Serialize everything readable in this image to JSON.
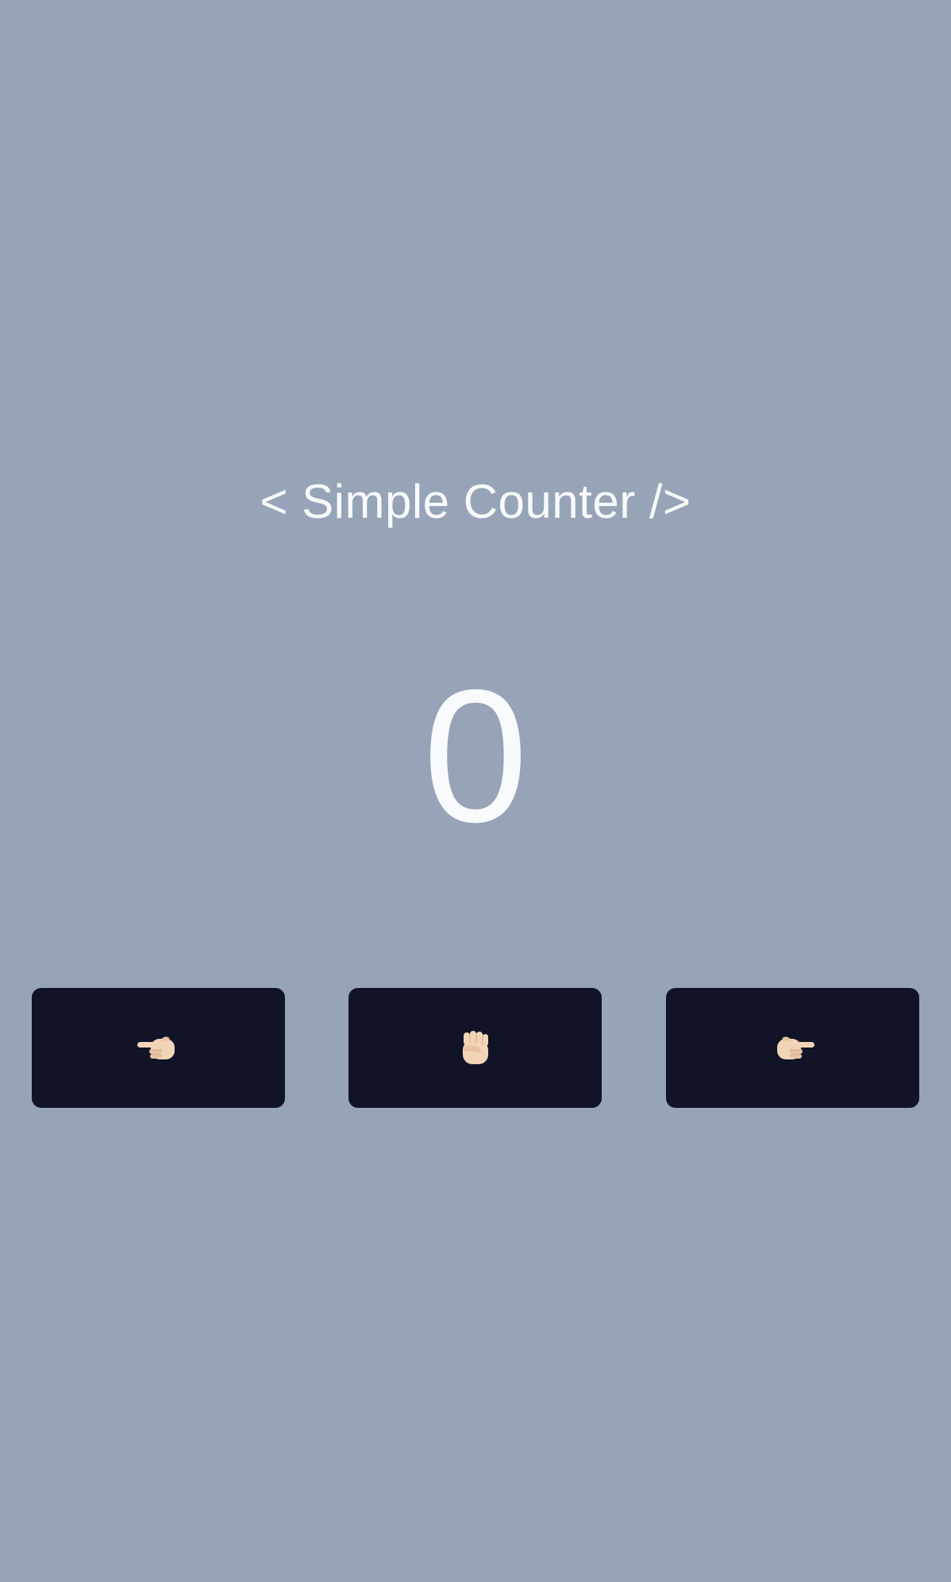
{
  "app": {
    "title": "< Simple Counter />"
  },
  "counter": {
    "value": "0"
  },
  "buttons": [
    {
      "name": "decrement-button",
      "icon": "pointing-left-hand-icon"
    },
    {
      "name": "reset-button",
      "icon": "raised-fist-icon"
    },
    {
      "name": "increment-button",
      "icon": "pointing-right-hand-icon"
    }
  ],
  "colors": {
    "background": "#97a4b7",
    "button": "#111427",
    "text": "#f8fafc",
    "skin": "#f2d4b6",
    "skin_shade": "#d9b494"
  }
}
